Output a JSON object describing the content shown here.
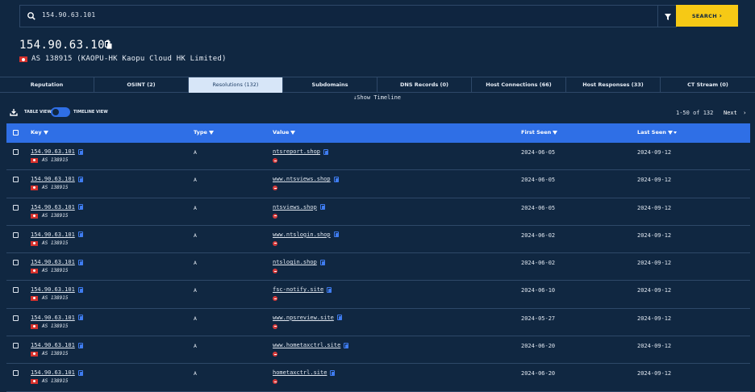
{
  "search": {
    "value": "154.90.63.101",
    "button_label": "SEARCH",
    "search_icon": "search-icon",
    "filter_icon": "filter-icon"
  },
  "header": {
    "ip": "154.90.63.101",
    "as_line": "AS 138915 (KAOPU-HK Kaopu Cloud HK Limited)",
    "flag_color": "#d6312c"
  },
  "tabs": [
    {
      "label": "Reputation"
    },
    {
      "label": "OSINT (2)"
    },
    {
      "label": "Resolutions (132)",
      "active": true
    },
    {
      "label": "Subdomains"
    },
    {
      "label": "DNS Records (0)"
    },
    {
      "label": "Host Connections (66)"
    },
    {
      "label": "Host Responses (33)"
    },
    {
      "label": "CT Stream (0)"
    }
  ],
  "timeline": {
    "label": "Show Timeline"
  },
  "toolbar": {
    "table_view": "TABLE VIEW",
    "timeline_view": "TIMELINE VIEW",
    "toggle_on": true
  },
  "pager": {
    "range": "1-50 of 132",
    "next": "Next"
  },
  "table": {
    "headers": {
      "key": "Key",
      "type": "Type",
      "value": "Value",
      "first_seen": "First Seen",
      "last_seen": "Last Seen"
    },
    "header_color": "#2f6fe6",
    "rows": [
      {
        "key": "154.90.63.101",
        "as": "AS 138915",
        "type": "A",
        "value": "ntsreport.shop",
        "first_seen": "2024-06-05",
        "last_seen": "2024-09-12"
      },
      {
        "key": "154.90.63.101",
        "as": "AS 138915",
        "type": "A",
        "value": "www.ntsviews.shop",
        "first_seen": "2024-06-05",
        "last_seen": "2024-09-12"
      },
      {
        "key": "154.90.63.101",
        "as": "AS 138915",
        "type": "A",
        "value": "ntsviews.shop",
        "first_seen": "2024-06-05",
        "last_seen": "2024-09-12"
      },
      {
        "key": "154.90.63.101",
        "as": "AS 138915",
        "type": "A",
        "value": "www.ntslogin.shop",
        "first_seen": "2024-06-02",
        "last_seen": "2024-09-12"
      },
      {
        "key": "154.90.63.101",
        "as": "AS 138915",
        "type": "A",
        "value": "ntslogin.shop",
        "first_seen": "2024-06-02",
        "last_seen": "2024-09-12"
      },
      {
        "key": "154.90.63.101",
        "as": "AS 138915",
        "type": "A",
        "value": "fsc-notify.site",
        "first_seen": "2024-06-10",
        "last_seen": "2024-09-12"
      },
      {
        "key": "154.90.63.101",
        "as": "AS 138915",
        "type": "A",
        "value": "www.npsreview.site",
        "first_seen": "2024-05-27",
        "last_seen": "2024-09-12"
      },
      {
        "key": "154.90.63.101",
        "as": "AS 138915",
        "type": "A",
        "value": "www.hometaxctrl.site",
        "first_seen": "2024-06-20",
        "last_seen": "2024-09-12"
      },
      {
        "key": "154.90.63.101",
        "as": "AS 138915",
        "type": "A",
        "value": "hometaxctrl.site",
        "first_seen": "2024-06-20",
        "last_seen": "2024-09-12"
      }
    ]
  }
}
